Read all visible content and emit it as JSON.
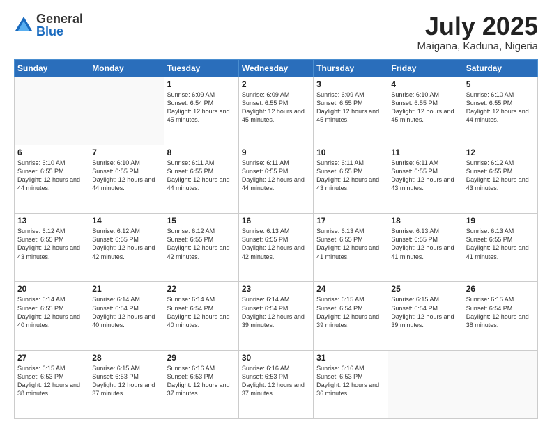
{
  "logo": {
    "general": "General",
    "blue": "Blue"
  },
  "header": {
    "month": "July 2025",
    "location": "Maigana, Kaduna, Nigeria"
  },
  "weekdays": [
    "Sunday",
    "Monday",
    "Tuesday",
    "Wednesday",
    "Thursday",
    "Friday",
    "Saturday"
  ],
  "weeks": [
    [
      {
        "day": "",
        "info": ""
      },
      {
        "day": "",
        "info": ""
      },
      {
        "day": "1",
        "info": "Sunrise: 6:09 AM\nSunset: 6:54 PM\nDaylight: 12 hours and 45 minutes."
      },
      {
        "day": "2",
        "info": "Sunrise: 6:09 AM\nSunset: 6:55 PM\nDaylight: 12 hours and 45 minutes."
      },
      {
        "day": "3",
        "info": "Sunrise: 6:09 AM\nSunset: 6:55 PM\nDaylight: 12 hours and 45 minutes."
      },
      {
        "day": "4",
        "info": "Sunrise: 6:10 AM\nSunset: 6:55 PM\nDaylight: 12 hours and 45 minutes."
      },
      {
        "day": "5",
        "info": "Sunrise: 6:10 AM\nSunset: 6:55 PM\nDaylight: 12 hours and 44 minutes."
      }
    ],
    [
      {
        "day": "6",
        "info": "Sunrise: 6:10 AM\nSunset: 6:55 PM\nDaylight: 12 hours and 44 minutes."
      },
      {
        "day": "7",
        "info": "Sunrise: 6:10 AM\nSunset: 6:55 PM\nDaylight: 12 hours and 44 minutes."
      },
      {
        "day": "8",
        "info": "Sunrise: 6:11 AM\nSunset: 6:55 PM\nDaylight: 12 hours and 44 minutes."
      },
      {
        "day": "9",
        "info": "Sunrise: 6:11 AM\nSunset: 6:55 PM\nDaylight: 12 hours and 44 minutes."
      },
      {
        "day": "10",
        "info": "Sunrise: 6:11 AM\nSunset: 6:55 PM\nDaylight: 12 hours and 43 minutes."
      },
      {
        "day": "11",
        "info": "Sunrise: 6:11 AM\nSunset: 6:55 PM\nDaylight: 12 hours and 43 minutes."
      },
      {
        "day": "12",
        "info": "Sunrise: 6:12 AM\nSunset: 6:55 PM\nDaylight: 12 hours and 43 minutes."
      }
    ],
    [
      {
        "day": "13",
        "info": "Sunrise: 6:12 AM\nSunset: 6:55 PM\nDaylight: 12 hours and 43 minutes."
      },
      {
        "day": "14",
        "info": "Sunrise: 6:12 AM\nSunset: 6:55 PM\nDaylight: 12 hours and 42 minutes."
      },
      {
        "day": "15",
        "info": "Sunrise: 6:12 AM\nSunset: 6:55 PM\nDaylight: 12 hours and 42 minutes."
      },
      {
        "day": "16",
        "info": "Sunrise: 6:13 AM\nSunset: 6:55 PM\nDaylight: 12 hours and 42 minutes."
      },
      {
        "day": "17",
        "info": "Sunrise: 6:13 AM\nSunset: 6:55 PM\nDaylight: 12 hours and 41 minutes."
      },
      {
        "day": "18",
        "info": "Sunrise: 6:13 AM\nSunset: 6:55 PM\nDaylight: 12 hours and 41 minutes."
      },
      {
        "day": "19",
        "info": "Sunrise: 6:13 AM\nSunset: 6:55 PM\nDaylight: 12 hours and 41 minutes."
      }
    ],
    [
      {
        "day": "20",
        "info": "Sunrise: 6:14 AM\nSunset: 6:55 PM\nDaylight: 12 hours and 40 minutes."
      },
      {
        "day": "21",
        "info": "Sunrise: 6:14 AM\nSunset: 6:54 PM\nDaylight: 12 hours and 40 minutes."
      },
      {
        "day": "22",
        "info": "Sunrise: 6:14 AM\nSunset: 6:54 PM\nDaylight: 12 hours and 40 minutes."
      },
      {
        "day": "23",
        "info": "Sunrise: 6:14 AM\nSunset: 6:54 PM\nDaylight: 12 hours and 39 minutes."
      },
      {
        "day": "24",
        "info": "Sunrise: 6:15 AM\nSunset: 6:54 PM\nDaylight: 12 hours and 39 minutes."
      },
      {
        "day": "25",
        "info": "Sunrise: 6:15 AM\nSunset: 6:54 PM\nDaylight: 12 hours and 39 minutes."
      },
      {
        "day": "26",
        "info": "Sunrise: 6:15 AM\nSunset: 6:54 PM\nDaylight: 12 hours and 38 minutes."
      }
    ],
    [
      {
        "day": "27",
        "info": "Sunrise: 6:15 AM\nSunset: 6:53 PM\nDaylight: 12 hours and 38 minutes."
      },
      {
        "day": "28",
        "info": "Sunrise: 6:15 AM\nSunset: 6:53 PM\nDaylight: 12 hours and 37 minutes."
      },
      {
        "day": "29",
        "info": "Sunrise: 6:16 AM\nSunset: 6:53 PM\nDaylight: 12 hours and 37 minutes."
      },
      {
        "day": "30",
        "info": "Sunrise: 6:16 AM\nSunset: 6:53 PM\nDaylight: 12 hours and 37 minutes."
      },
      {
        "day": "31",
        "info": "Sunrise: 6:16 AM\nSunset: 6:53 PM\nDaylight: 12 hours and 36 minutes."
      },
      {
        "day": "",
        "info": ""
      },
      {
        "day": "",
        "info": ""
      }
    ]
  ]
}
